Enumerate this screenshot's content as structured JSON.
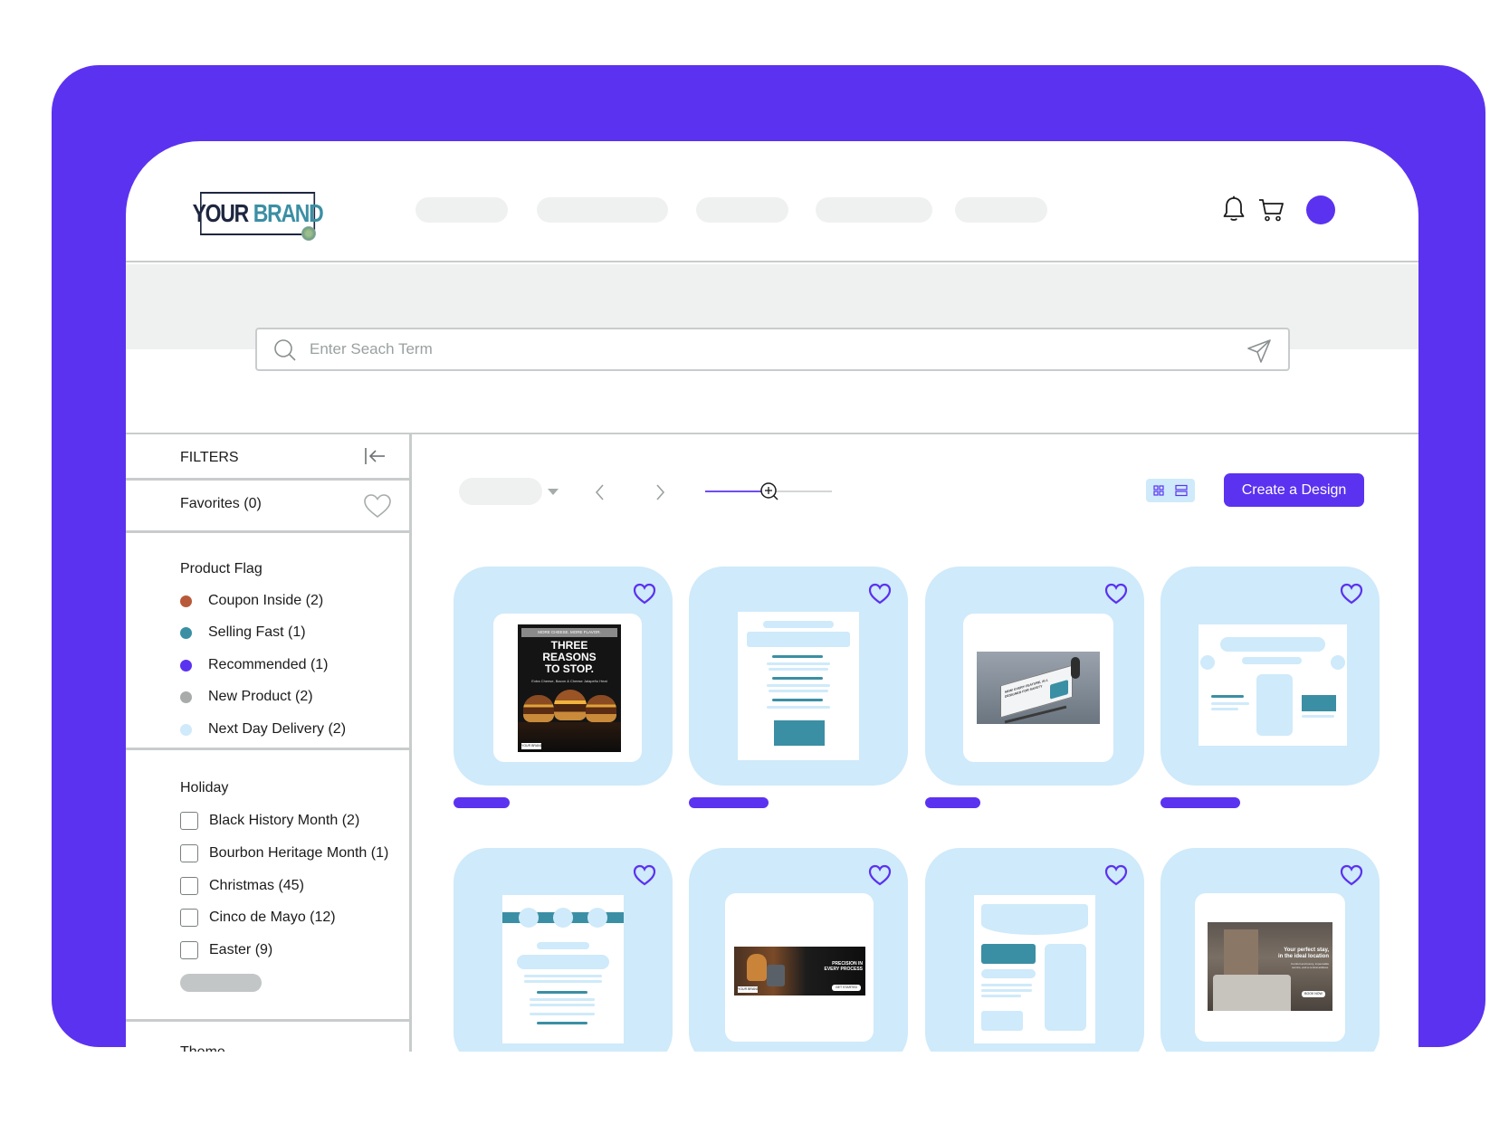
{
  "brand": {
    "word1": "YOUR",
    "word2": "BRAND"
  },
  "header": {
    "icons": [
      "bell-icon",
      "cart-icon",
      "avatar"
    ],
    "accent_color": "#5b32f0"
  },
  "search": {
    "placeholder": "Enter Seach Term"
  },
  "sidebar": {
    "filters_label": "FILTERS",
    "favorites_label": "Favorites (0)",
    "product_flag": {
      "title": "Product Flag",
      "items": [
        {
          "label": "Coupon Inside (2)",
          "color": "#b85a3a"
        },
        {
          "label": "Selling Fast (1)",
          "color": "#3b8fa4"
        },
        {
          "label": "Recommended (1)",
          "color": "#5b32f0"
        },
        {
          "label": "New Product (2)",
          "color": "#a9abab"
        },
        {
          "label": "Next Day Delivery (2)",
          "color": "#cfeafa"
        }
      ]
    },
    "holiday": {
      "title": "Holiday",
      "items": [
        {
          "label": "Black History Month (2)"
        },
        {
          "label": "Bourbon Heritage Month (1)"
        },
        {
          "label": "Christmas (45)"
        },
        {
          "label": "Cinco de Mayo (12)"
        },
        {
          "label": "Easter (9)"
        }
      ]
    },
    "theme_title": "Theme"
  },
  "toolbar": {
    "create_label": "Create a Design"
  },
  "thumbnails": {
    "burger_flyer": {
      "top": "MORE CHEESE. MORE FLAVOR.",
      "headline1": "THREE",
      "headline2": "REASONS",
      "headline3": "TO STOP.",
      "sub": "Extra Cheese, Bacon & Cheese Jalapeño Heat",
      "badge": "YOUR BRAND"
    },
    "billboard": {
      "text": "NEW! EVERY FEATURE, ALL DESIGNED FOR SAFETY"
    },
    "precision_banner": {
      "line1": "PRECISION IN",
      "line2": "EVERY PROCESS",
      "cta": "GET STARTED",
      "badge": "YOUR BRAND"
    },
    "hotel_ad": {
      "line1": "Your perfect stay,",
      "line2": "in the ideal location",
      "sub": "Comfort and luxury, impeccable service, and a central address.",
      "cta": "BOOK NOW"
    }
  }
}
